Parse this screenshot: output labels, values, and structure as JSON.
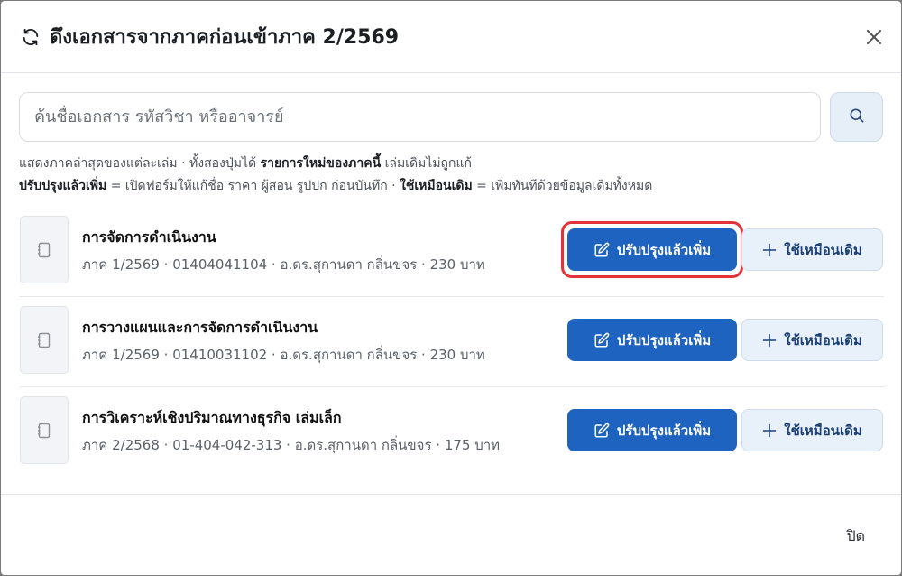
{
  "dialog": {
    "title": "ดึงเอกสารจากภาคก่อนเข้าภาค 2/2569",
    "close_label": "ปิด"
  },
  "search": {
    "placeholder": "ค้นชื่อเอกสาร รหัสวิชา หรืออาจารย์"
  },
  "help": {
    "line1_a": "แสดงภาคล่าสุดของแต่ละเล่ม · ทั้งสองปุ่มได้ ",
    "line1_b": "รายการใหม่ของภาคนี้",
    "line1_c": " เล่มเดิมไม่ถูกแก้",
    "line2_a": "ปรับปรุงแล้วเพิ่ม",
    "line2_b": " = เปิดฟอร์มให้แก้ชื่อ ราคา ผู้สอน รูปปก ก่อนบันทึก · ",
    "line2_c": "ใช้เหมือนเดิม",
    "line2_d": " = เพิ่มทันทีด้วยข้อมูลเดิมทั้งหมด"
  },
  "items": [
    {
      "title": "การจัดการดำเนินงาน",
      "meta": "ภาค 1/2569 · 01404041104 · อ.ดร.สุกานดา กลิ่นขจร · 230 บาท",
      "primary_label": "ปรับปรุงแล้วเพิ่ม",
      "secondary_label": "ใช้เหมือนเดิม"
    },
    {
      "title": "การวางแผนและการจัดการดำเนินงาน",
      "meta": "ภาค 1/2569 · 01410031102 · อ.ดร.สุกานดา กลิ่นขจร · 230 บาท",
      "primary_label": "ปรับปรุงแล้วเพิ่ม",
      "secondary_label": "ใช้เหมือนเดิม"
    },
    {
      "title": "การวิเคราะห์เชิงปริมาณทางธุรกิจ เล่มเล็ก",
      "meta": "ภาค 2/2568 · 01-404-042-313 · อ.ดร.สุกานดา กลิ่นขจร · 175 บาท",
      "primary_label": "ปรับปรุงแล้วเพิ่ม",
      "secondary_label": "ใช้เหมือนเดิม"
    }
  ],
  "colors": {
    "primary": "#1e63bf",
    "secondary_bg": "#e8f0fa",
    "highlight": "#e2333b"
  },
  "icons": {
    "header": "refresh-icon",
    "close": "close-icon",
    "search": "search-icon",
    "document": "document-icon",
    "edit": "edit-icon",
    "add": "plus-icon"
  }
}
